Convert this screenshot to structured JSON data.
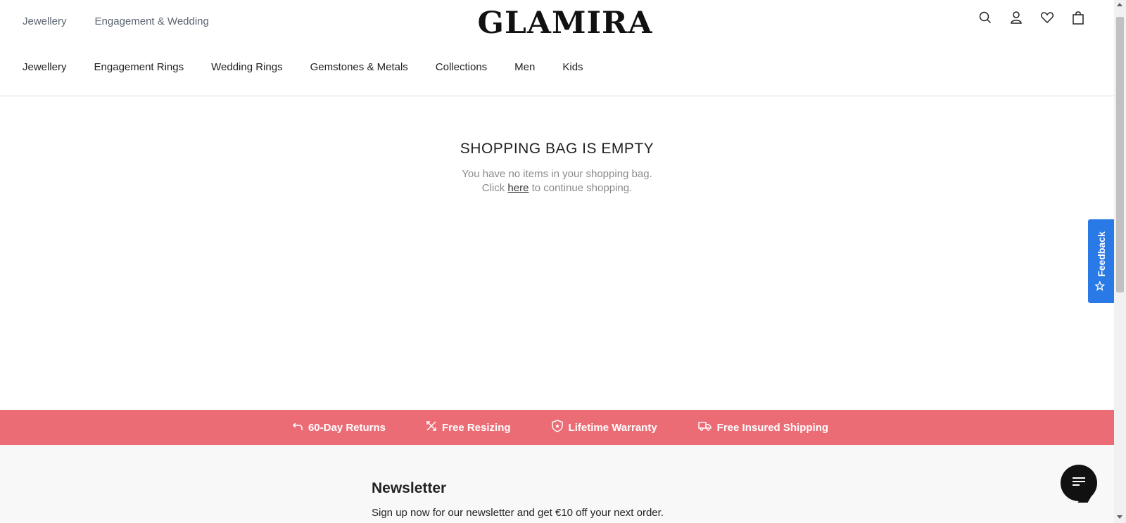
{
  "header": {
    "top_links": [
      "Jewellery",
      "Engagement & Wedding"
    ],
    "logo": "GLAMIRA",
    "icons": [
      "search-icon",
      "user-icon",
      "heart-icon",
      "shopping-bag-icon"
    ]
  },
  "nav": {
    "items": [
      "Jewellery",
      "Engagement Rings",
      "Wedding Rings",
      "Gemstones & Metals",
      "Collections",
      "Men",
      "Kids"
    ]
  },
  "main": {
    "title": "SHOPPING BAG IS EMPTY",
    "line1": "You have no items in your shopping bag.",
    "line2_prefix": "Click ",
    "line2_link": "here",
    "line2_suffix": " to continue shopping."
  },
  "feedback": {
    "label": "Feedback",
    "color": "#2979e6"
  },
  "benefits": {
    "color": "#ec6c76",
    "items": [
      {
        "icon": "return-arrow-icon",
        "label": "60-Day Returns"
      },
      {
        "icon": "resize-cross-icon",
        "label": "Free Resizing"
      },
      {
        "icon": "shield-icon",
        "label": "Lifetime Warranty"
      },
      {
        "icon": "truck-icon",
        "label": "Free Insured Shipping"
      }
    ]
  },
  "newsletter": {
    "title": "Newsletter",
    "text": "Sign up now for our newsletter and get €10 off your next order."
  },
  "chat": {
    "icon": "chat-menu-icon"
  }
}
